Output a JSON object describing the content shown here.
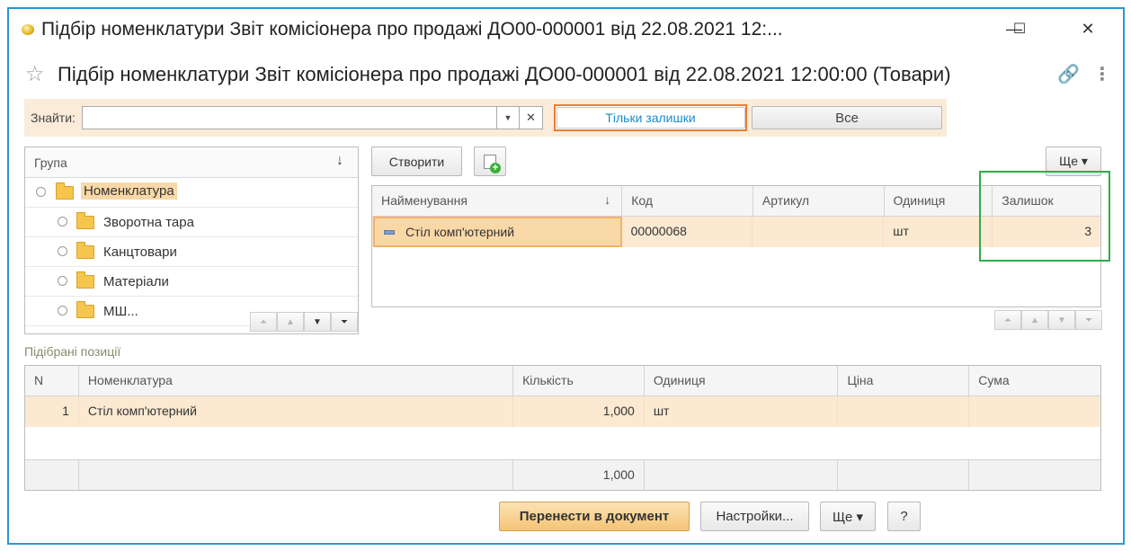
{
  "window": {
    "title": "Підбір номенклатури Звіт комісіонера про продажі ДО00-000001 від 22.08.2021 12:...",
    "minimize": "—",
    "maximize": "☐",
    "close": "✕"
  },
  "header": {
    "title": "Підбір номенклатури Звіт комісіонера про продажі ДО00-000001 від 22.08.2021 12:00:00 (Товари)",
    "link_icon": "🔗",
    "more_icon": "⋮"
  },
  "search": {
    "label": "Знайти:",
    "value": "",
    "dropdown": "▼",
    "clear": "✕",
    "toggle_active": "Тільки залишки",
    "toggle_other": "Все"
  },
  "groups": {
    "header": "Група",
    "sort_icon": "↓",
    "items": [
      {
        "label": "Номенклатура",
        "exp": "⊖"
      },
      {
        "label": "Зворотна тара",
        "exp": "⊕"
      },
      {
        "label": "Канцтовари",
        "exp": "⊕"
      },
      {
        "label": "Матеріали",
        "exp": "⊕"
      },
      {
        "label": "МШ...",
        "exp": "⊕"
      }
    ]
  },
  "products": {
    "create_button": "Створити",
    "more_button": "Ще ▾",
    "columns": [
      "Найменування",
      "Код",
      "Артикул",
      "Одиниця",
      "Залишок"
    ],
    "sort_icon": "↓",
    "rows": [
      {
        "name": "Стіл комп'ютерний",
        "code": "00000068",
        "article": "",
        "unit": "шт",
        "stock": "3"
      }
    ]
  },
  "selected": {
    "label": "Підібрані позиції",
    "columns": [
      "N",
      "Номенклатура",
      "Кількість",
      "Одиниця",
      "Ціна",
      "Сума"
    ],
    "rows": [
      {
        "n": "1",
        "item": "Стіл комп'ютерний",
        "qty": "1,000",
        "unit": "шт",
        "price": "",
        "sum": ""
      }
    ],
    "total_qty": "1,000"
  },
  "footer": {
    "transfer": "Перенести в документ",
    "settings": "Настройки...",
    "more": "Ще ▾",
    "help": "?"
  }
}
